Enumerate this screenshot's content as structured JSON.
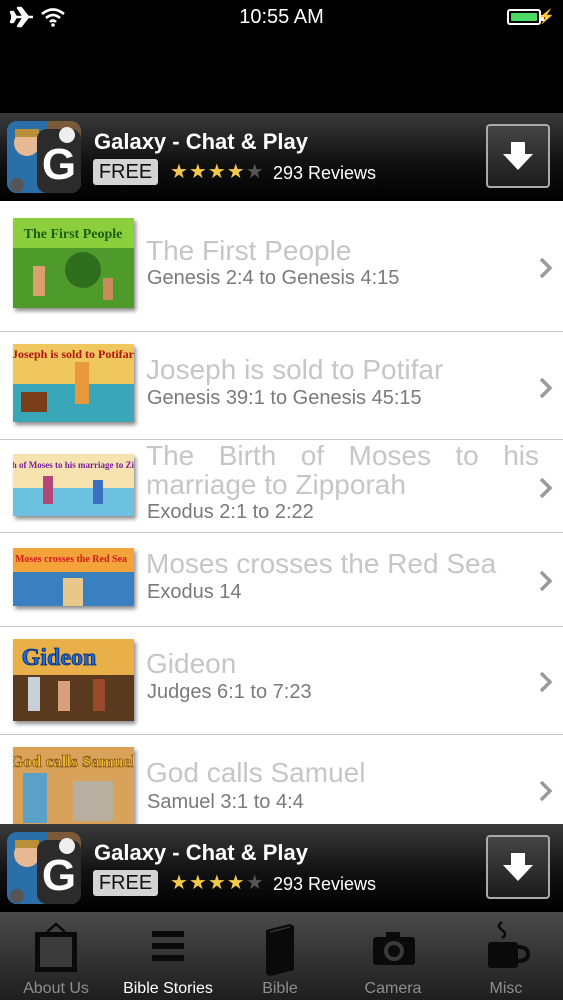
{
  "status_bar": {
    "time": "10:55 AM"
  },
  "ad": {
    "app_name": "Galaxy - Chat & Play",
    "price": "FREE",
    "rating_stars": 4,
    "rating_max": 5,
    "reviews": "293 Reviews",
    "icon_letter": "G"
  },
  "stories": [
    {
      "title": "The First People",
      "ref": "Genesis 2:4 to Genesis 4:15",
      "thumb_caption": "The First People",
      "thumb_color": "#3a9d2e"
    },
    {
      "title": "Joseph is sold to Potifar",
      "ref": "Genesis 39:1 to Genesis 45:15",
      "thumb_caption": "Joseph is sold to Potifar",
      "thumb_color": "#d98a1a"
    },
    {
      "title": "The Birth of Moses to his marriage to Zipporah",
      "ref": "Exodus 2:1 to 2:22",
      "thumb_caption": "The birth of Moses to his marriage to Zipporah",
      "thumb_color": "#6b2fa3"
    },
    {
      "title": "Moses crosses the Red Sea",
      "ref": "Exodus 14",
      "thumb_caption": "Moses crosses the Red Sea",
      "thumb_color": "#c0202a"
    },
    {
      "title": "Gideon",
      "ref": "Judges 6:1 to 7:23",
      "thumb_caption": "Gideon",
      "thumb_color": "#1e63c6"
    },
    {
      "title": "God calls Samuel",
      "ref": "Samuel 3:1 to 4:4",
      "thumb_caption": "God calls Samuel",
      "thumb_color": "#e2b21c"
    }
  ],
  "tabs": [
    {
      "label": "About Us",
      "icon": "tv-icon",
      "active": false
    },
    {
      "label": "Bible Stories",
      "icon": "list-icon",
      "active": true
    },
    {
      "label": "Bible",
      "icon": "book-icon",
      "active": false
    },
    {
      "label": "Camera",
      "icon": "camera-icon",
      "active": false
    },
    {
      "label": "Misc",
      "icon": "coffee-cup-icon",
      "active": false
    }
  ],
  "colors": {
    "accent_star": "#f2c94c",
    "battery": "#4cd964",
    "title_text": "#c6c6c6",
    "ref_text": "#7a7a7a"
  }
}
